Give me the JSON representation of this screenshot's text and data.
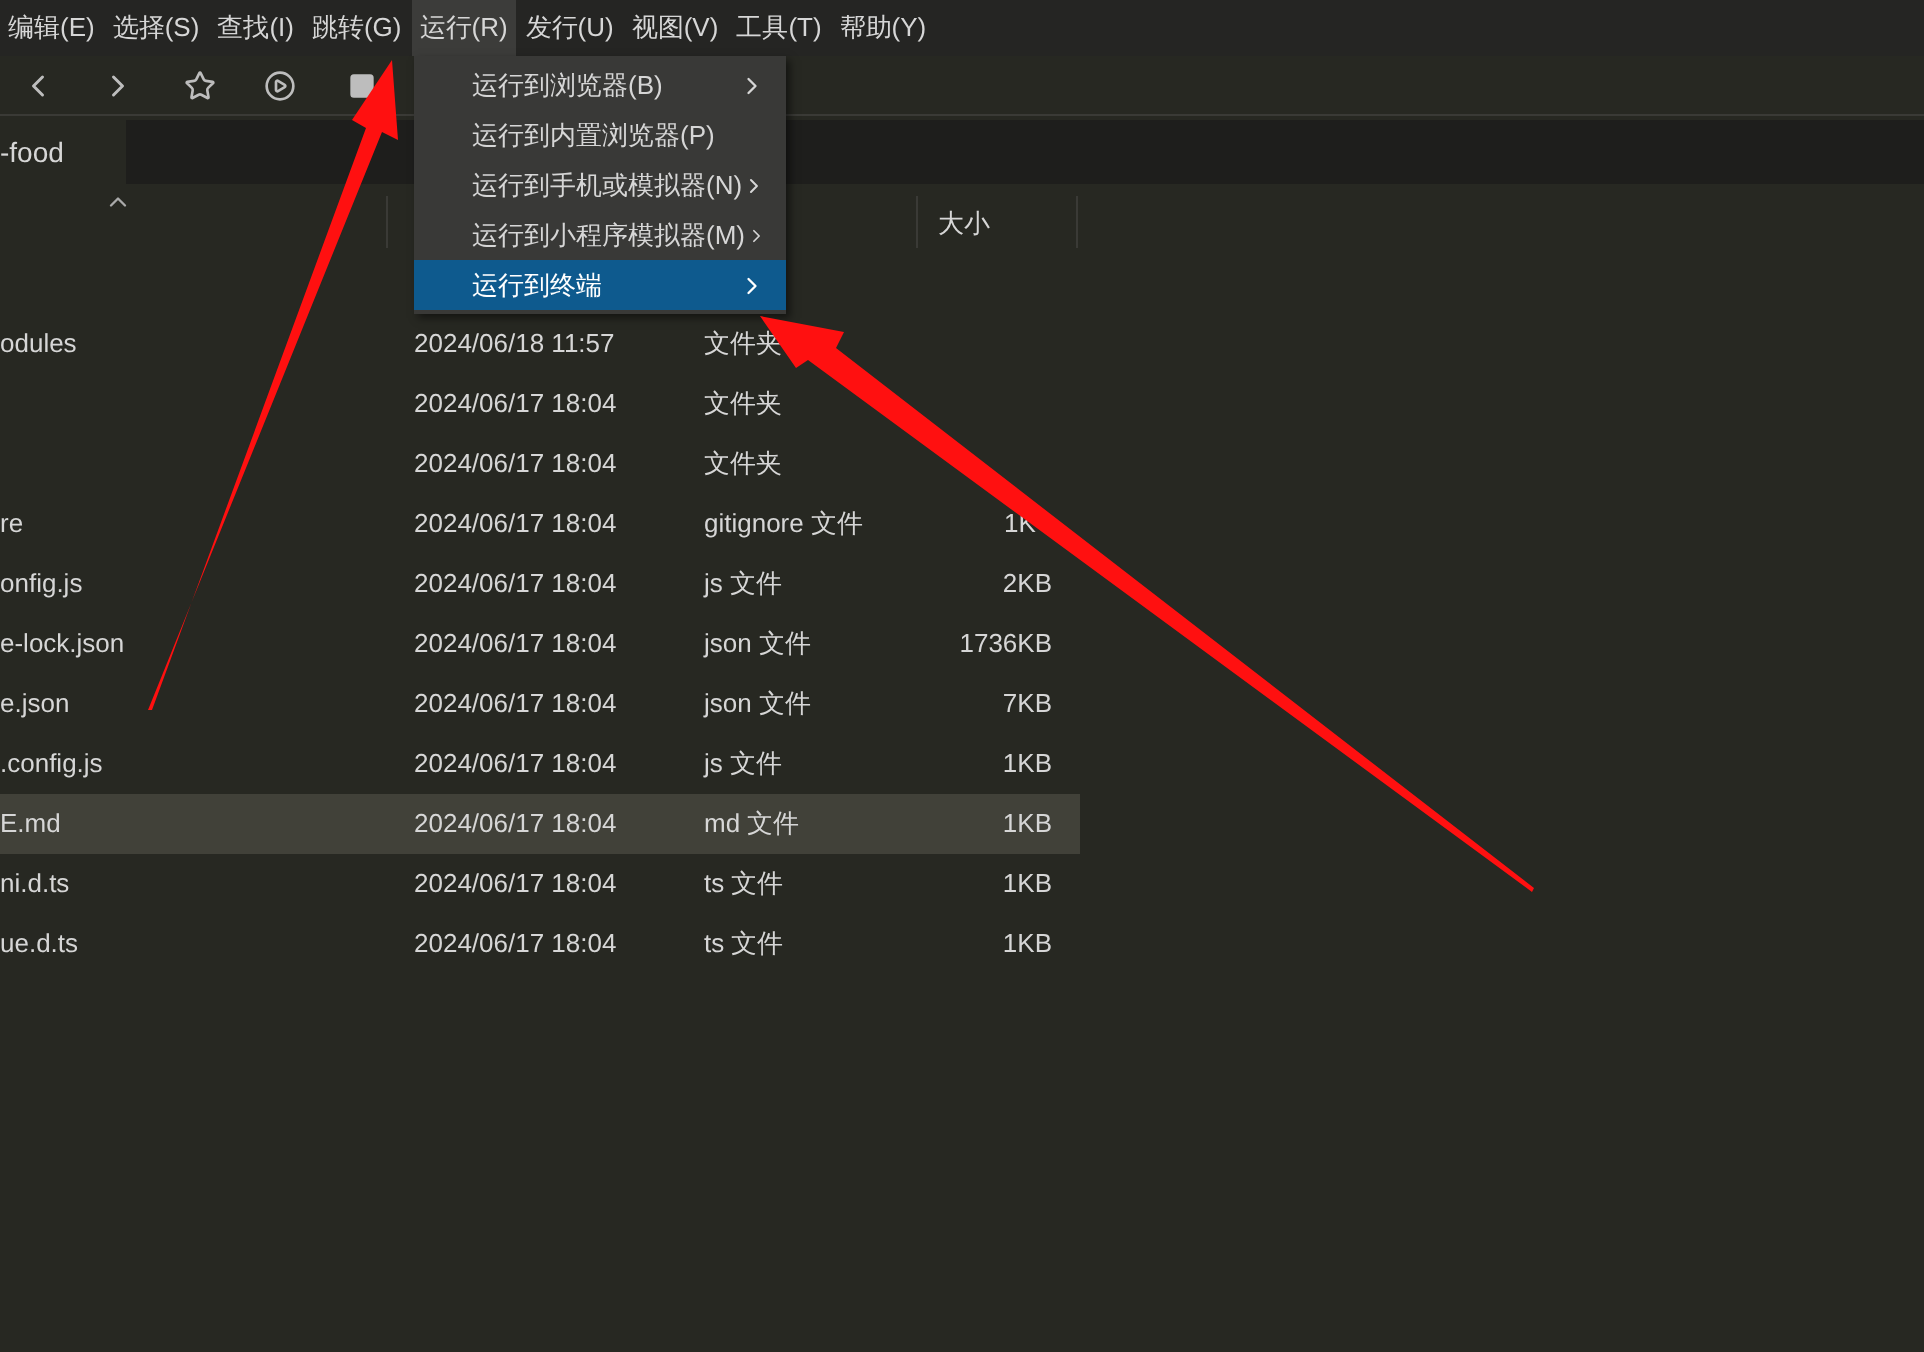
{
  "menu_bar": [
    {
      "label": "编辑(E)",
      "selected": false
    },
    {
      "label": "选择(S)",
      "selected": false
    },
    {
      "label": "查找(I)",
      "selected": false
    },
    {
      "label": "跳转(G)",
      "selected": false
    },
    {
      "label": "运行(R)",
      "selected": true
    },
    {
      "label": "发行(U)",
      "selected": false
    },
    {
      "label": "视图(V)",
      "selected": false
    },
    {
      "label": "工具(T)",
      "selected": false
    },
    {
      "label": "帮助(Y)",
      "selected": false
    }
  ],
  "tab": {
    "label": "-food"
  },
  "table": {
    "columns": [
      "大小"
    ],
    "rows": [
      {
        "name": "odules",
        "modified": "2024/06/18 11:57",
        "type": "文件夹",
        "size": "",
        "selected": false
      },
      {
        "name": "",
        "modified": "2024/06/17 18:04",
        "type": "文件夹",
        "size": "",
        "selected": false
      },
      {
        "name": "",
        "modified": "2024/06/17 18:04",
        "type": "文件夹",
        "size": "",
        "selected": false
      },
      {
        "name": "re",
        "modified": "2024/06/17 18:04",
        "type": "gitignore 文件",
        "size": "1K",
        "selected": false
      },
      {
        "name": "onfig.js",
        "modified": "2024/06/17 18:04",
        "type": "js 文件",
        "size": "2KB",
        "selected": false
      },
      {
        "name": "e-lock.json",
        "modified": "2024/06/17 18:04",
        "type": "json 文件",
        "size": "1736KB",
        "selected": false
      },
      {
        "name": "e.json",
        "modified": "2024/06/17 18:04",
        "type": "json 文件",
        "size": "7KB",
        "selected": false
      },
      {
        "name": ".config.js",
        "modified": "2024/06/17 18:04",
        "type": "js 文件",
        "size": "1KB",
        "selected": false
      },
      {
        "name": "E.md",
        "modified": "2024/06/17 18:04",
        "type": "md 文件",
        "size": "1KB",
        "selected": true
      },
      {
        "name": "ni.d.ts",
        "modified": "2024/06/17 18:04",
        "type": "ts 文件",
        "size": "1KB",
        "selected": false
      },
      {
        "name": "ue.d.ts",
        "modified": "2024/06/17 18:04",
        "type": "ts 文件",
        "size": "1KB",
        "selected": false
      }
    ]
  },
  "dropdown_menu": [
    {
      "label": "运行到浏览器(B)",
      "submenu": true,
      "selected": false
    },
    {
      "label": "运行到内置浏览器(P)",
      "submenu": false,
      "selected": false
    },
    {
      "label": "运行到手机或模拟器(N)",
      "submenu": true,
      "selected": false
    },
    {
      "label": "运行到小程序模拟器(M)",
      "submenu": true,
      "selected": false
    },
    {
      "label": "运行到终端",
      "submenu": true,
      "selected": true
    }
  ]
}
